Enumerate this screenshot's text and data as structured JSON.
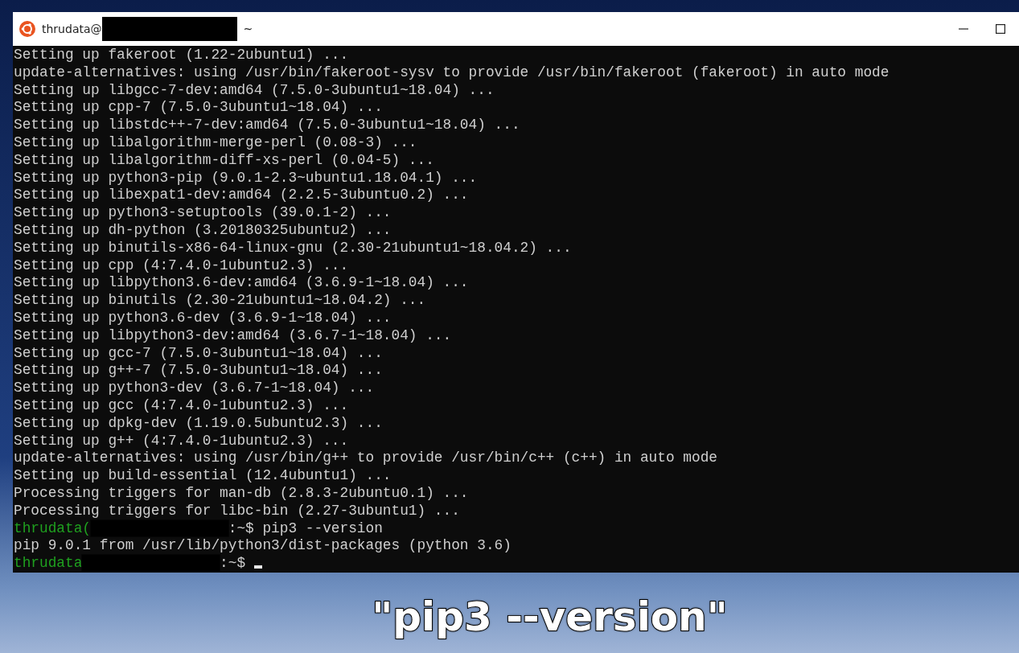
{
  "window": {
    "title_user": "thrudata@",
    "title_path": "~"
  },
  "terminal": {
    "lines": [
      {
        "kind": "output",
        "text": "Setting up fakeroot (1.22-2ubuntu1) ..."
      },
      {
        "kind": "output",
        "text": "update-alternatives: using /usr/bin/fakeroot-sysv to provide /usr/bin/fakeroot (fakeroot) in auto mode"
      },
      {
        "kind": "output",
        "text": "Setting up libgcc-7-dev:amd64 (7.5.0-3ubuntu1~18.04) ..."
      },
      {
        "kind": "output",
        "text": "Setting up cpp-7 (7.5.0-3ubuntu1~18.04) ..."
      },
      {
        "kind": "output",
        "text": "Setting up libstdc++-7-dev:amd64 (7.5.0-3ubuntu1~18.04) ..."
      },
      {
        "kind": "output",
        "text": "Setting up libalgorithm-merge-perl (0.08-3) ..."
      },
      {
        "kind": "output",
        "text": "Setting up libalgorithm-diff-xs-perl (0.04-5) ..."
      },
      {
        "kind": "output",
        "text": "Setting up python3-pip (9.0.1-2.3~ubuntu1.18.04.1) ..."
      },
      {
        "kind": "output",
        "text": "Setting up libexpat1-dev:amd64 (2.2.5-3ubuntu0.2) ..."
      },
      {
        "kind": "output",
        "text": "Setting up python3-setuptools (39.0.1-2) ..."
      },
      {
        "kind": "output",
        "text": "Setting up dh-python (3.20180325ubuntu2) ..."
      },
      {
        "kind": "output",
        "text": "Setting up binutils-x86-64-linux-gnu (2.30-21ubuntu1~18.04.2) ..."
      },
      {
        "kind": "output",
        "text": "Setting up cpp (4:7.4.0-1ubuntu2.3) ..."
      },
      {
        "kind": "output",
        "text": "Setting up libpython3.6-dev:amd64 (3.6.9-1~18.04) ..."
      },
      {
        "kind": "output",
        "text": "Setting up binutils (2.30-21ubuntu1~18.04.2) ..."
      },
      {
        "kind": "output",
        "text": "Setting up python3.6-dev (3.6.9-1~18.04) ..."
      },
      {
        "kind": "output",
        "text": "Setting up libpython3-dev:amd64 (3.6.7-1~18.04) ..."
      },
      {
        "kind": "output",
        "text": "Setting up gcc-7 (7.5.0-3ubuntu1~18.04) ..."
      },
      {
        "kind": "output",
        "text": "Setting up g++-7 (7.5.0-3ubuntu1~18.04) ..."
      },
      {
        "kind": "output",
        "text": "Setting up python3-dev (3.6.7-1~18.04) ..."
      },
      {
        "kind": "output",
        "text": "Setting up gcc (4:7.4.0-1ubuntu2.3) ..."
      },
      {
        "kind": "output",
        "text": "Setting up dpkg-dev (1.19.0.5ubuntu2.3) ..."
      },
      {
        "kind": "output",
        "text": "Setting up g++ (4:7.4.0-1ubuntu2.3) ..."
      },
      {
        "kind": "output",
        "text": "update-alternatives: using /usr/bin/g++ to provide /usr/bin/c++ (c++) in auto mode"
      },
      {
        "kind": "output",
        "text": "Setting up build-essential (12.4ubuntu1) ..."
      },
      {
        "kind": "output",
        "text": "Processing triggers for man-db (2.8.3-2ubuntu0.1) ..."
      },
      {
        "kind": "output",
        "text": "Processing triggers for libc-bin (2.27-3ubuntu1) ..."
      },
      {
        "kind": "prompt",
        "user": "thrudata(",
        "suffix": ":~$",
        "command": "pip3 --version"
      },
      {
        "kind": "output",
        "text": "pip 9.0.1 from /usr/lib/python3/dist-packages (python 3.6)"
      },
      {
        "kind": "prompt",
        "user": "thrudata",
        "suffix": ":~$",
        "cursor": true
      }
    ]
  },
  "caption": "\"pip3 --version\""
}
